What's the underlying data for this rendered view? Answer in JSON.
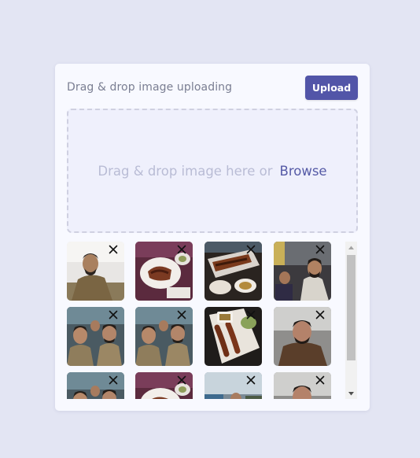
{
  "uploader": {
    "title": "Drag & drop image uploading",
    "upload_label": "Upload",
    "dropzone_text": "Drag & drop image here or",
    "browse_label": "Browse"
  },
  "colors": {
    "background": "#e3e5f3",
    "card": "#f8f9ff",
    "accent": "#5255a8",
    "dropzone_fill": "#eff0fc",
    "dropzone_border": "#cfd0e1"
  },
  "gallery": {
    "images": [
      {
        "scene": "man-selfie-outdoor",
        "remove_icon": "close-icon"
      },
      {
        "scene": "food-plates",
        "remove_icon": "close-icon"
      },
      {
        "scene": "food-tray",
        "remove_icon": "close-icon"
      },
      {
        "scene": "man-at-table",
        "remove_icon": "close-icon"
      },
      {
        "scene": "group-selfie",
        "remove_icon": "close-icon"
      },
      {
        "scene": "group-selfie",
        "remove_icon": "close-icon"
      },
      {
        "scene": "food-platter",
        "remove_icon": "close-icon"
      },
      {
        "scene": "man-portrait",
        "remove_icon": "close-icon"
      },
      {
        "scene": "group-selfie",
        "remove_icon": "close-icon"
      },
      {
        "scene": "food-plates",
        "remove_icon": "close-icon"
      },
      {
        "scene": "street-scene",
        "remove_icon": "close-icon"
      },
      {
        "scene": "man-portrait",
        "remove_icon": "close-icon"
      }
    ]
  }
}
